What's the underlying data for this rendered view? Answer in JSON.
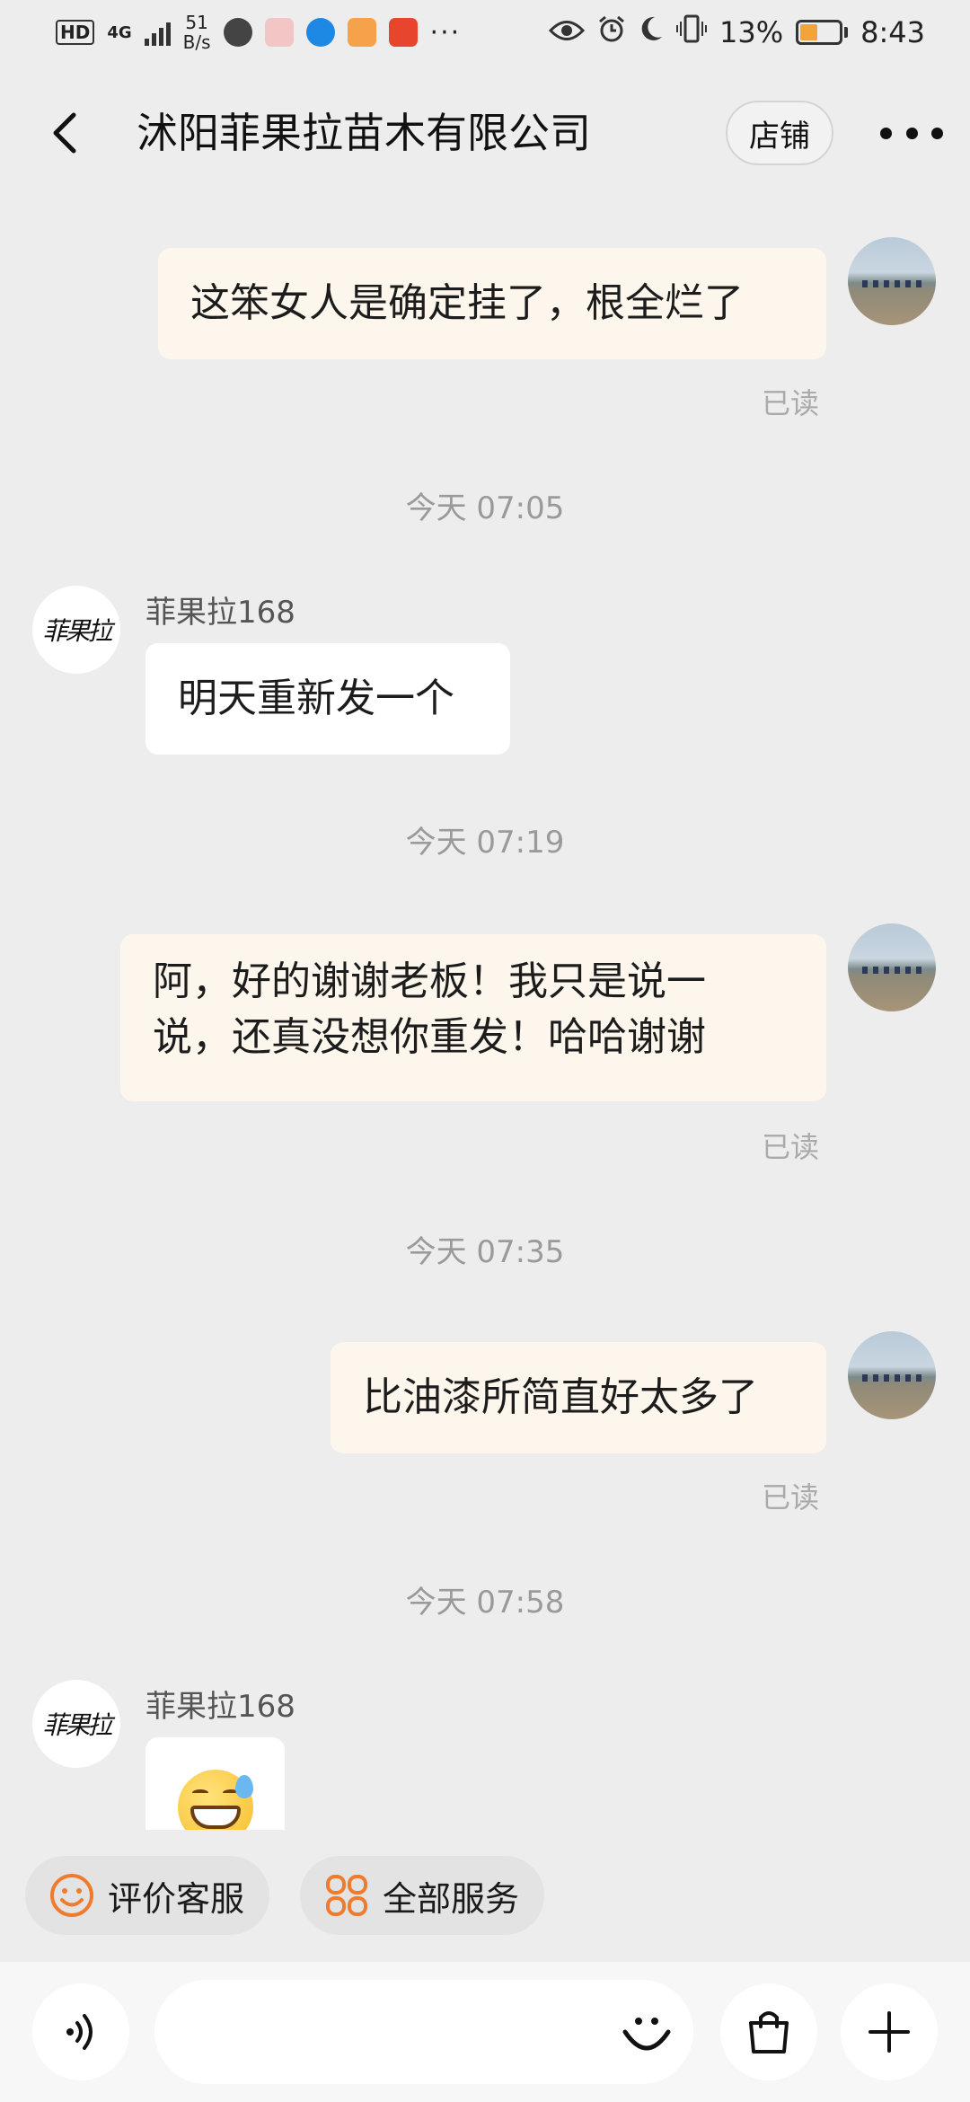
{
  "status_bar": {
    "net_badge": "HD",
    "net_type": "4G",
    "speed_value": "51",
    "speed_unit": "B/s",
    "app_icons": [
      "browser-icon",
      "shop-app-icon",
      "edge-icon",
      "health-app-icon",
      "red-app-icon"
    ],
    "more": "···",
    "battery": "13%",
    "battery_level": 0.13,
    "time": "8:43"
  },
  "header": {
    "title": "沭阳菲果拉苗木有限公司",
    "shop_label": "店铺"
  },
  "messages": [
    {
      "direction": "out",
      "text": "这笨女人是确定挂了，根全烂了",
      "status": "已读"
    },
    {
      "time": "今天  07:05"
    },
    {
      "direction": "in",
      "sender": "菲果拉168",
      "text": "明天重新发一个"
    },
    {
      "time": "今天  07:19"
    },
    {
      "direction": "out",
      "text_line1": "阿，好的谢谢老板！我只是说一",
      "text_line2": "说，还真没想你重发！哈哈谢谢",
      "status": "已读"
    },
    {
      "time": "今天  07:35"
    },
    {
      "direction": "out",
      "text": "比油漆所简直好太多了",
      "status": "已读"
    },
    {
      "time": "今天  07:58"
    },
    {
      "direction": "in",
      "sender": "菲果拉168",
      "emoji": "grinning-sweat-emoji"
    }
  ],
  "avatar_logo_text": "菲果拉",
  "quick_actions": [
    {
      "label": "评价客服",
      "icon": "smiley-icon"
    },
    {
      "label": "全部服务",
      "icon": "grid-icon"
    }
  ],
  "colors": {
    "background": "#ededed",
    "outgoing_bubble": "#fdf6ec",
    "incoming_bubble": "#ffffff",
    "accent_orange": "#f07b2f"
  }
}
